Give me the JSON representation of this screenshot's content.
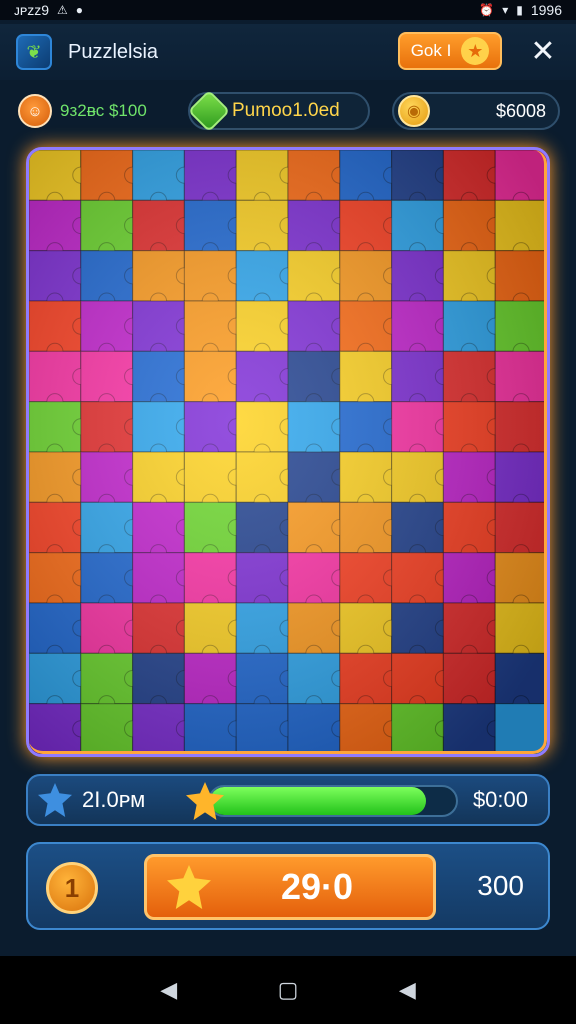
{
  "status_bar": {
    "left_text": "ᴊᴘᴢᴢ9",
    "time": "1996"
  },
  "header": {
    "app_title": "Puzzlelsia",
    "go_label": "Gok I",
    "close_glyph": "✕"
  },
  "stats": {
    "player_score": "9ᴈ2ᴃc $100",
    "gem_label": "Pumoo1.0ed",
    "coin_amount": "$6008"
  },
  "board": {
    "cols": 10,
    "rows": 12,
    "palette": [
      "#1b67d6",
      "#2aa6f0",
      "#7d2ad8",
      "#c41fd0",
      "#ff2ea6",
      "#ffd21c",
      "#ff6a10",
      "#e82b2b",
      "#ff3d1e",
      "#6ad82a",
      "#1e3f8f",
      "#ff9a1a"
    ]
  },
  "progress": {
    "label": "2I.0ᴘᴍ",
    "value_text": "$0:00",
    "fill_percent": 88
  },
  "action": {
    "coin_glyph": "1",
    "play_value": "29·0",
    "right_value": "300"
  },
  "nav": {
    "back": "◀",
    "home": "▢",
    "recent": "◀"
  }
}
